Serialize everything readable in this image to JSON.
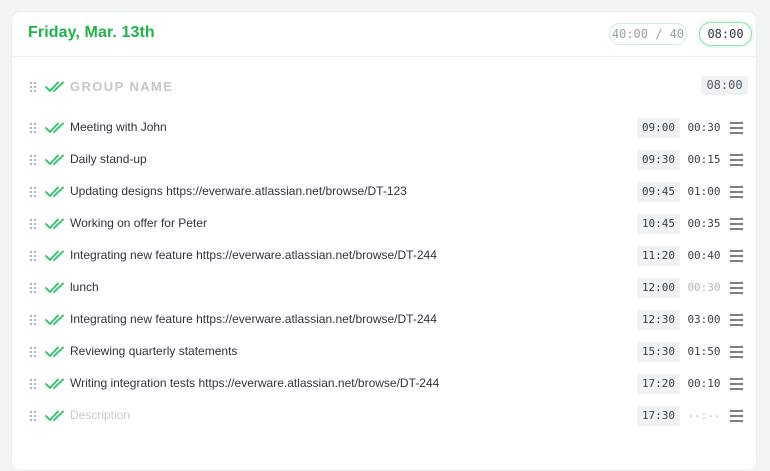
{
  "header": {
    "day": "Friday, Mar. 13th",
    "total": "40:00 / 40",
    "time": "08:00"
  },
  "group": {
    "name": "GROUP NAME",
    "time": "08:00"
  },
  "colors": {
    "accent": "#1fb34a",
    "check": "#22c55e"
  },
  "entries": [
    {
      "desc": "Meeting with John",
      "start": "09:00",
      "dur": "00:30"
    },
    {
      "desc": "Daily stand-up",
      "start": "09:30",
      "dur": "00:15"
    },
    {
      "desc": "Updating designs https://everware.atlassian.net/browse/DT-123",
      "start": "09:45",
      "dur": "01:00"
    },
    {
      "desc": "Working on offer for Peter",
      "start": "10:45",
      "dur": "00:35"
    },
    {
      "desc": "Integrating new feature https://everware.atlassian.net/browse/DT-244",
      "start": "11:20",
      "dur": "00:40"
    },
    {
      "desc": "lunch",
      "start": "12:00",
      "dur": "00:30"
    },
    {
      "desc": "Integrating new feature https://everware.atlassian.net/browse/DT-244",
      "start": "12:30",
      "dur": "03:00"
    },
    {
      "desc": "Reviewing quarterly statements",
      "start": "15:30",
      "dur": "01:50"
    },
    {
      "desc": "Writing integration tests https://everware.atlassian.net/browse/DT-244",
      "start": "17:20",
      "dur": "00:10"
    }
  ],
  "new_entry": {
    "placeholder": "Description",
    "start": "17:30",
    "dur": "--:--"
  }
}
